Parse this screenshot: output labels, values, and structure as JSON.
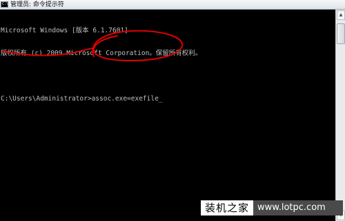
{
  "window": {
    "title": "管理员: 命令提示符",
    "icon_text": "C:\\"
  },
  "console": {
    "line1": "Microsoft Windows [版本 6.1.7601]",
    "line2": "版权所有 (c) 2009 Microsoft Corporation。保留所有权利。",
    "prompt": "C:\\Users\\Administrator>",
    "command": "assoc.exe=exefile",
    "cursor": "_"
  },
  "watermark": {
    "cn": "装机之家",
    "url": "www.lotpc.com"
  },
  "colors": {
    "console_bg": "#000000",
    "console_text": "#c0c0c0",
    "annotation": "#e00000"
  }
}
